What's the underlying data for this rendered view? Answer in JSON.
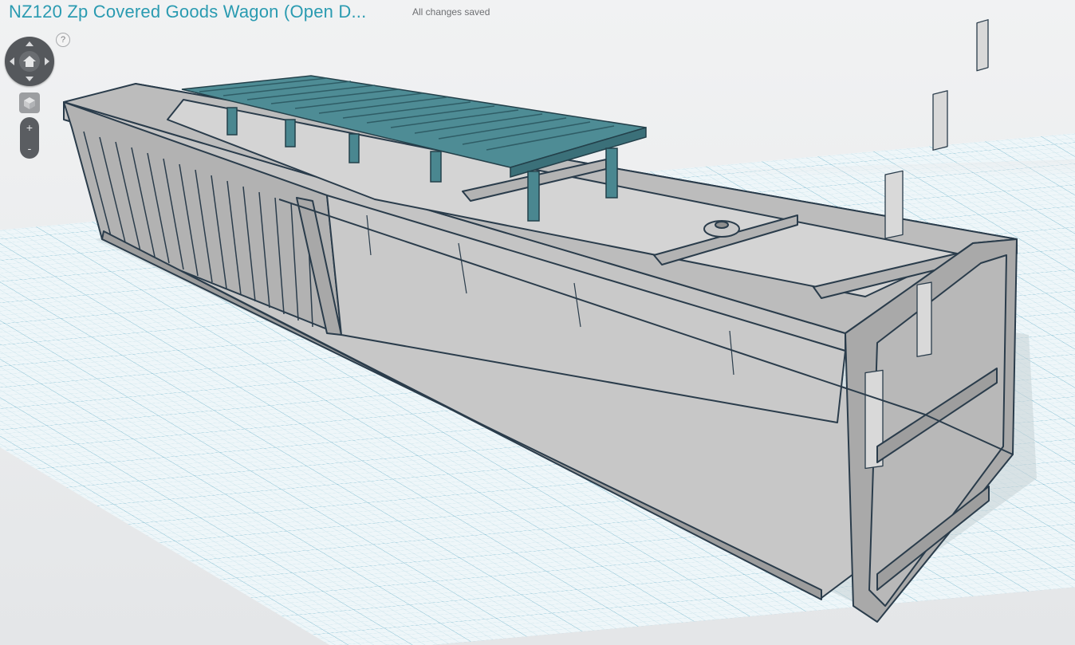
{
  "design": {
    "title": "NZ120 Zp Covered Goods Wagon (Open D...",
    "save_status": "All changes saved"
  },
  "controls": {
    "help_label": "?",
    "zoom_in_label": "+",
    "zoom_out_label": "-",
    "icons": [
      "home-icon",
      "arrow-up-icon",
      "arrow-down-icon",
      "arrow-left-icon",
      "arrow-right-icon",
      "view-cube-icon"
    ]
  },
  "colors": {
    "title": "#2a9bb1",
    "grid_line": "#9ccbd9",
    "grid_major": "#6fb3c9",
    "model_gray": "#b9b9b9",
    "model_edge": "#25394a",
    "roof_walk": "#4f8e96"
  }
}
